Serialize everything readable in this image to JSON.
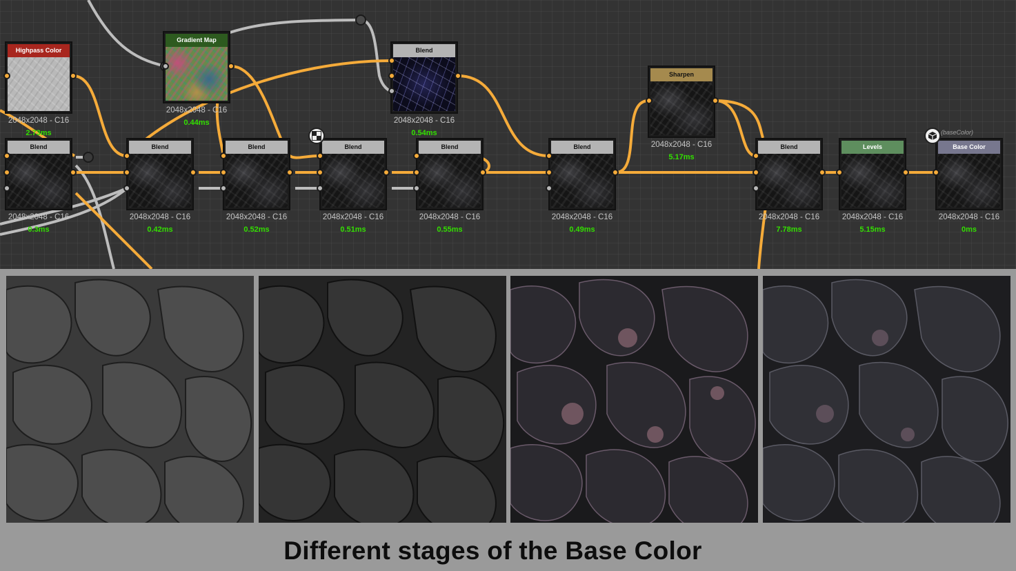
{
  "nodes": [
    {
      "id": "highpass",
      "title": "Highpass Color",
      "resolution": "2048x2048 - C16",
      "time": "2.73ms",
      "header_color": "#a8261e"
    },
    {
      "id": "gradient",
      "title": "Gradient Map",
      "resolution": "2048x2048 - C16",
      "time": "0.44ms",
      "header_color": "#2d5a1f"
    },
    {
      "id": "blend_top",
      "title": "Blend",
      "resolution": "2048x2048 - C16",
      "time": "0.54ms",
      "header_color": "#b4b4b4"
    },
    {
      "id": "sharpen",
      "title": "Sharpen",
      "resolution": "2048x2048 - C16",
      "time": "5.17ms",
      "header_color": "#a58a4e"
    },
    {
      "id": "blend1",
      "title": "Blend",
      "resolution": "2048x2048 - C16",
      "time": "0.3ms",
      "header_color": "#b4b4b4"
    },
    {
      "id": "blend2",
      "title": "Blend",
      "resolution": "2048x2048 - C16",
      "time": "0.42ms",
      "header_color": "#b4b4b4"
    },
    {
      "id": "blend3",
      "title": "Blend",
      "resolution": "2048x2048 - C16",
      "time": "0.52ms",
      "header_color": "#b4b4b4"
    },
    {
      "id": "blend4",
      "title": "Blend",
      "resolution": "2048x2048 - C16",
      "time": "0.51ms",
      "header_color": "#b4b4b4"
    },
    {
      "id": "blend5",
      "title": "Blend",
      "resolution": "2048x2048 - C16",
      "time": "0.55ms",
      "header_color": "#b4b4b4"
    },
    {
      "id": "blend6",
      "title": "Blend",
      "resolution": "2048x2048 - C16",
      "time": "0.49ms",
      "header_color": "#b4b4b4"
    },
    {
      "id": "blend7",
      "title": "Blend",
      "resolution": "2048x2048 - C16",
      "time": "7.78ms",
      "header_color": "#b4b4b4"
    },
    {
      "id": "levels",
      "title": "Levels",
      "resolution": "2048x2048 - C16",
      "time": "5.15ms",
      "header_color": "#5e8e5e"
    },
    {
      "id": "basecolor",
      "title": "Base Color",
      "resolution": "2048x2048 - C16",
      "time": "0ms",
      "header_color": "#77778e"
    }
  ],
  "output_identifier": "(baseColor)",
  "caption": "Different stages of the Base Color",
  "colors": {
    "wire": "#f5ab3a",
    "wire_grey": "#bdbdbd",
    "time_text": "#33e000",
    "graph_bg": "#333333"
  },
  "icons": {
    "frame_badge": "checker-icon",
    "output_badge": "cube-icon"
  }
}
